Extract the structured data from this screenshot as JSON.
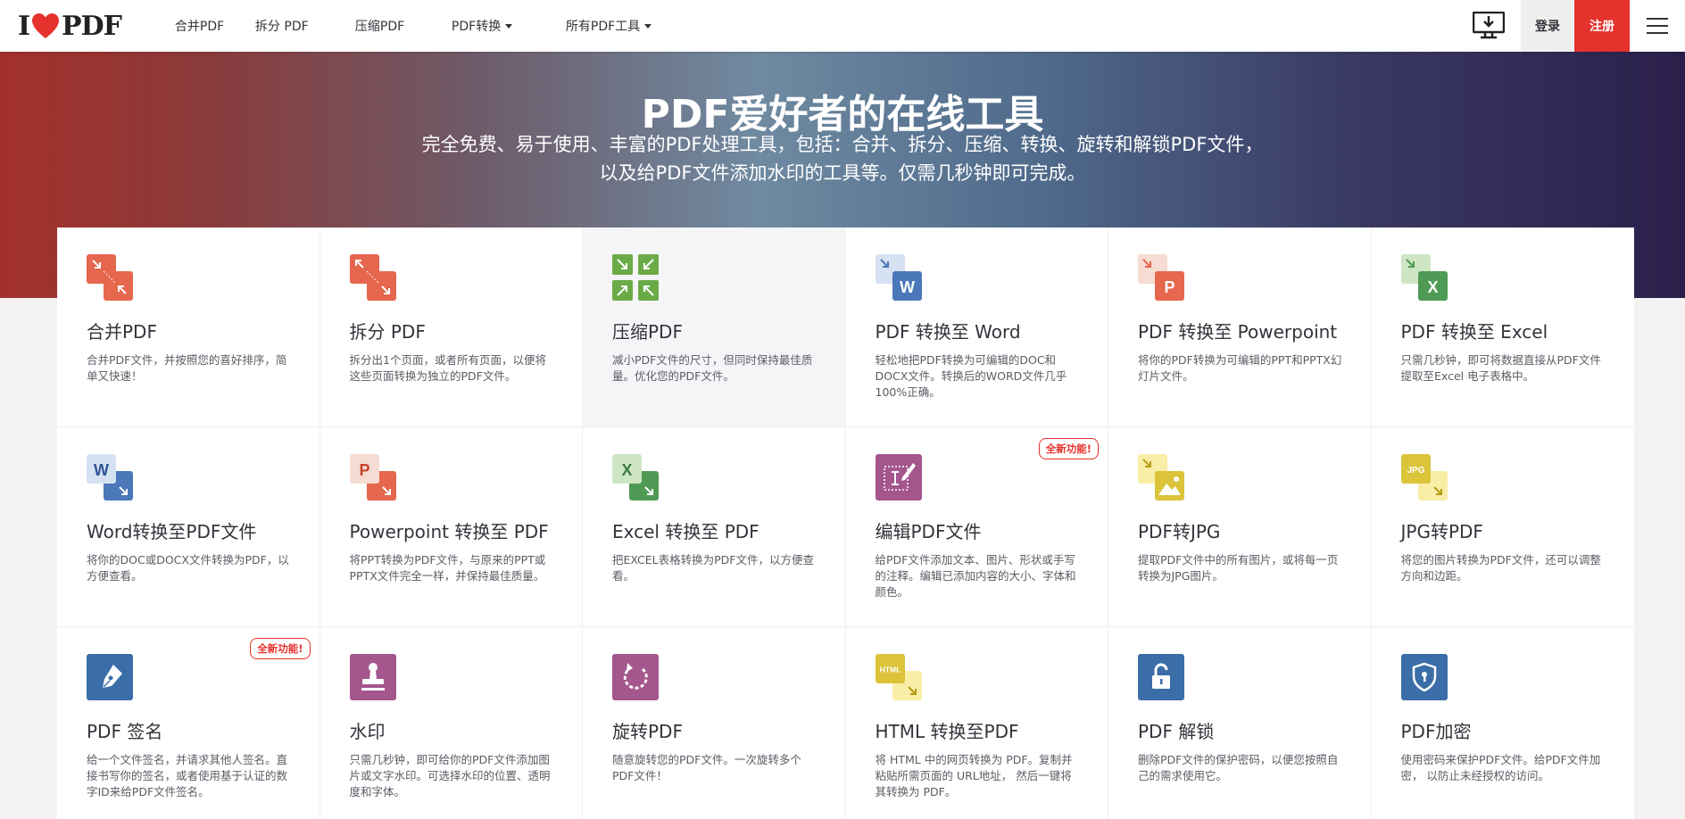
{
  "brand": {
    "text_left": "I",
    "text_right": "PDF"
  },
  "nav": {
    "items": [
      {
        "label": "合并PDF",
        "dropdown": false
      },
      {
        "label": "拆分 PDF",
        "dropdown": false
      },
      {
        "label": "压缩PDF",
        "dropdown": false
      },
      {
        "label": "PDF转换",
        "dropdown": true
      },
      {
        "label": "所有PDF工具",
        "dropdown": true
      }
    ],
    "login": "登录",
    "signup": "注册"
  },
  "hero": {
    "title": "PDF爱好者的在线工具",
    "subtitle": "完全免费、易于使用、丰富的PDF处理工具，包括：合并、拆分、压缩、转换、旋转和解锁PDF文件，以及给PDF文件添加水印的工具等。仅需几秒钟即可完成。"
  },
  "badge_text": "全新功能!",
  "colors": {
    "brand_red": "#e5322d",
    "orange": "#e5674d",
    "green": "#6aab48",
    "blue": "#4a78b8",
    "purple": "#a4568d",
    "yellow": "#dbc33a",
    "steel": "#3b6ea8"
  },
  "tools": [
    {
      "title": "合并PDF",
      "desc": "合并PDF文件，并按照您的喜好排序，简单又快速！",
      "icon": "merge-icon",
      "badge": false
    },
    {
      "title": "拆分 PDF",
      "desc": "拆分出1个页面，或者所有页面，以便将这些页面转换为独立的PDF文件。",
      "icon": "split-icon",
      "badge": false
    },
    {
      "title": "压缩PDF",
      "desc": "减小PDF文件的尺寸，但同时保持最佳质量。优化您的PDF文件。",
      "icon": "compress-icon",
      "badge": false
    },
    {
      "title": "PDF 转换至 Word",
      "desc": "轻松地把PDF转换为可编辑的DOC和DOCX文件。转换后的WORD文件几乎100%正确。",
      "icon": "pdf-to-word-icon",
      "badge": false
    },
    {
      "title": "PDF 转换至 Powerpoint",
      "desc": "将你的PDF转换为可编辑的PPT和PPTX幻灯片文件。",
      "icon": "pdf-to-ppt-icon",
      "badge": false
    },
    {
      "title": "PDF 转换至 Excel",
      "desc": "只需几秒钟，即可将数据直接从PDF文件提取至Excel 电子表格中。",
      "icon": "pdf-to-excel-icon",
      "badge": false
    },
    {
      "title": "Word转换至PDF文件",
      "desc": "将你的DOC或DOCX文件转换为PDF，以方便查看。",
      "icon": "word-to-pdf-icon",
      "badge": false
    },
    {
      "title": "Powerpoint 转换至 PDF",
      "desc": "将PPT转换为PDF文件，与原来的PPT或PPTX文件完全一样，并保持最佳质量。",
      "icon": "ppt-to-pdf-icon",
      "badge": false
    },
    {
      "title": "Excel 转换至 PDF",
      "desc": "把EXCEL表格转换为PDF文件，以方便查看。",
      "icon": "excel-to-pdf-icon",
      "badge": false
    },
    {
      "title": "编辑PDF文件",
      "desc": "给PDF文件添加文本、图片、形状或手写的注释。编辑已添加内容的大小、字体和颜色。",
      "icon": "edit-pdf-icon",
      "badge": true
    },
    {
      "title": "PDF转JPG",
      "desc": "提取PDF文件中的所有图片，或将每一页转换为JPG图片。",
      "icon": "pdf-to-jpg-icon",
      "badge": false
    },
    {
      "title": "JPG转PDF",
      "desc": "将您的图片转换为PDF文件，还可以调整方向和边距。",
      "icon": "jpg-to-pdf-icon",
      "badge": false
    },
    {
      "title": "PDF 签名",
      "desc": "给一个文件签名，并请求其他人签名。直接书写你的签名，或者使用基于认证的数字ID来给PDF文件签名。",
      "icon": "sign-pdf-icon",
      "badge": true
    },
    {
      "title": "水印",
      "desc": "只需几秒钟，即可给你的PDF文件添加图片或文字水印。可选择水印的位置、透明度和字体。",
      "icon": "watermark-icon",
      "badge": false
    },
    {
      "title": "旋转PDF",
      "desc": "随意旋转您的PDF文件。一次旋转多个PDF文件！",
      "icon": "rotate-icon",
      "badge": false
    },
    {
      "title": "HTML 转换至PDF",
      "desc": "将 HTML 中的网页转换为 PDF。复制并粘贴所需页面的 URL地址， 然后一键将其转换为 PDF。",
      "icon": "html-to-pdf-icon",
      "badge": false
    },
    {
      "title": "PDF 解锁",
      "desc": "删除PDF文件的保护密码，以便您按照自己的需求使用它。",
      "icon": "unlock-icon",
      "badge": false
    },
    {
      "title": "PDF加密",
      "desc": "使用密码来保护PDF文件。给PDF文件加密， 以防止未经授权的访问。",
      "icon": "protect-icon",
      "badge": false
    }
  ]
}
